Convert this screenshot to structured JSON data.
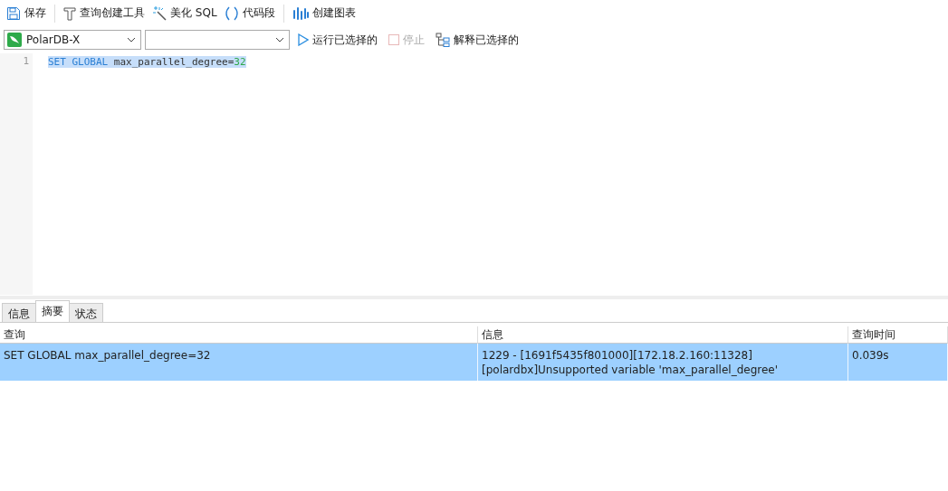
{
  "toolbar": [
    {
      "kind": "save",
      "label": "保存"
    },
    {
      "kind": "builder",
      "label": "查询创建工具"
    },
    {
      "kind": "beautify",
      "label": "美化 SQL"
    },
    {
      "kind": "snippet",
      "label": "代码段"
    },
    {
      "kind": "chart",
      "label": "创建图表"
    }
  ],
  "connection_select": {
    "value": "PolarDB-X"
  },
  "actions": [
    {
      "kind": "run",
      "label": "运行已选择的",
      "disabled": false
    },
    {
      "kind": "stop",
      "label": "停止",
      "disabled": true
    },
    {
      "kind": "explain",
      "label": "解释已选择的",
      "disabled": false
    }
  ],
  "editor": {
    "lines": [
      {
        "number": "1",
        "selected": true,
        "tokens": [
          {
            "kind": "keyword",
            "text": "SET GLOBAL"
          },
          {
            "kind": "plain",
            "text": " max_parallel_degree="
          },
          {
            "kind": "number",
            "text": "32"
          }
        ]
      }
    ]
  },
  "result_tabs": [
    {
      "label": "信息",
      "selected": false
    },
    {
      "label": "摘要",
      "selected": true
    },
    {
      "label": "状态",
      "selected": false
    }
  ],
  "table": {
    "columns": [
      "查询",
      "信息",
      "查询时间"
    ],
    "rows": [
      {
        "selected": true,
        "cells": [
          "SET GLOBAL max_parallel_degree=32",
          "1229 - [1691f5435f801000][172.18.2.160:11328][polardbx]Unsupported variable 'max_parallel_degree'",
          "0.039s"
        ]
      }
    ]
  }
}
